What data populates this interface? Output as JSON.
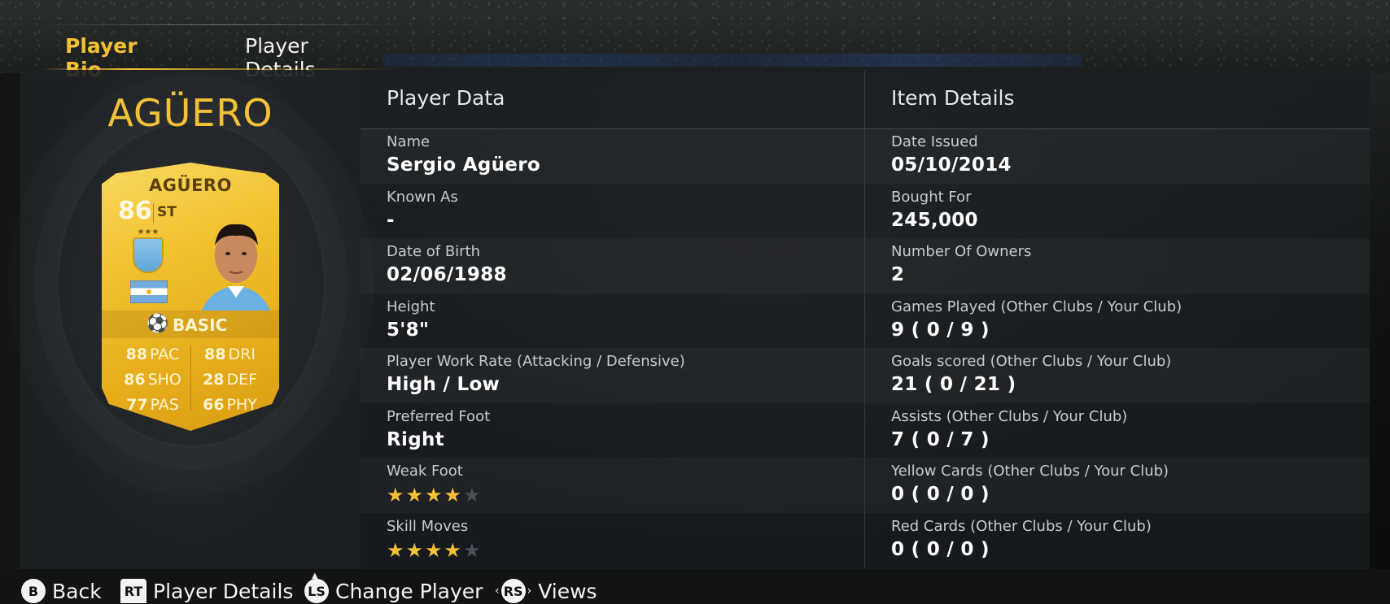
{
  "tabs": {
    "player_bio": "Player Bio",
    "player_details": "Player Details"
  },
  "player": {
    "title": "AGÜERO"
  },
  "card": {
    "name": "AGÜERO",
    "rating": "86",
    "position": "ST",
    "chemistry": "BASIC",
    "stats": [
      {
        "value": "88",
        "label": "PAC"
      },
      {
        "value": "88",
        "label": "DRI"
      },
      {
        "value": "86",
        "label": "SHO"
      },
      {
        "value": "28",
        "label": "DEF"
      },
      {
        "value": "77",
        "label": "PAS"
      },
      {
        "value": "66",
        "label": "PHY"
      }
    ]
  },
  "player_data": {
    "title": "Player Data",
    "rows": [
      {
        "label": "Name",
        "value": "Sergio Agüero"
      },
      {
        "label": "Known As",
        "value": "-"
      },
      {
        "label": "Date of Birth",
        "value": "02/06/1988"
      },
      {
        "label": "Height",
        "value": "5'8\""
      },
      {
        "label": "Player Work Rate (Attacking / Defensive)",
        "value": "High / Low"
      },
      {
        "label": "Preferred Foot",
        "value": "Right"
      }
    ],
    "weak_foot": {
      "label": "Weak Foot",
      "rating": 4,
      "max": 5
    },
    "skill_moves": {
      "label": "Skill Moves",
      "rating": 4,
      "max": 5
    }
  },
  "item_details": {
    "title": "Item Details",
    "rows": [
      {
        "label": "Date Issued",
        "value": "05/10/2014"
      },
      {
        "label": "Bought For",
        "value": "245,000"
      },
      {
        "label": "Number Of Owners",
        "value": "2"
      },
      {
        "label": "Games Played (Other Clubs / Your Club)",
        "value": "9 ( 0 / 9 )"
      },
      {
        "label": "Goals scored (Other Clubs / Your Club)",
        "value": "21 ( 0 / 21 )"
      },
      {
        "label": "Assists (Other Clubs / Your Club)",
        "value": "7 ( 0 / 7 )"
      },
      {
        "label": "Yellow Cards (Other Clubs / Your Club)",
        "value": "0 ( 0 / 0 )"
      },
      {
        "label": "Red Cards (Other Clubs / Your Club)",
        "value": "0 ( 0 / 0 )"
      }
    ]
  },
  "footer": {
    "back": {
      "button": "B",
      "label": "Back"
    },
    "player_details": {
      "button": "RT",
      "label": "Player Details"
    },
    "change_player": {
      "button": "LS",
      "label": "Change Player"
    },
    "views": {
      "button": "RS",
      "label": "Views"
    }
  },
  "colors": {
    "accent": "#f3c136",
    "card_gold": "#f2c12f",
    "star_off": "#4a5156",
    "panel": "#191e22"
  }
}
